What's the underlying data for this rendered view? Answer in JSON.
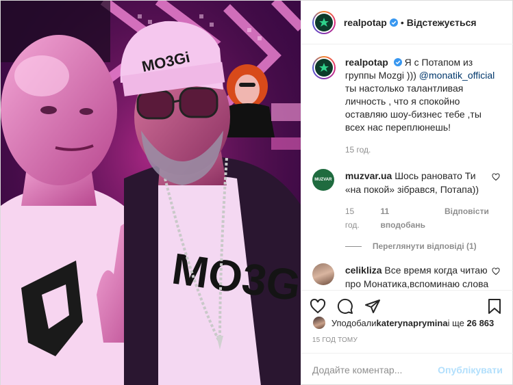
{
  "header": {
    "username": "realpotap",
    "follow_state": "Відстежується"
  },
  "caption": {
    "username": "realpotap",
    "text_before": "Я с Потапом из группы Mozgi ))) ",
    "mention": "@monatik_official",
    "text_after": " ты настолько талантливая личность , что я спокойно оставляю шоу-бизнес тебе ,ты всех нас переплюнешь!",
    "time": "15 год."
  },
  "comments": [
    {
      "username": "muzvar.ua",
      "avatar_text": "MUZVAR",
      "text": "Шось рановато Ти «на покой» зібрався, Потапа))",
      "time": "15 год.",
      "likes": "11 вподобань",
      "reply": "Відповісти"
    },
    {
      "username": "celikliza",
      "text": "Все время когда читаю про Монатика,вспоминаю слова Сереги,что он не талантливый. Где Серёга сейчас а где"
    }
  ],
  "view_replies": "Переглянути відповіді (1)",
  "photo_cap_text": "MO3Gi",
  "photo_shirt_text": "MO3G",
  "likes_line": {
    "prefix": "Уподобали ",
    "user": "katerynaprymina",
    "middle": " і ще ",
    "count": "26 863"
  },
  "post_time": "15 ГОД ТОМУ",
  "comment_input": {
    "placeholder": "Додайте коментар..."
  },
  "publish_label": "Опублікувати",
  "icons": [
    "like-icon",
    "comment-icon",
    "share-icon",
    "bookmark-icon",
    "verified-icon",
    "heart-small-icon"
  ],
  "colors": {
    "link": "#00376b",
    "verified": "#3897f0",
    "muted": "#8e8e8e",
    "publish_disabled": "#b2dffc"
  }
}
